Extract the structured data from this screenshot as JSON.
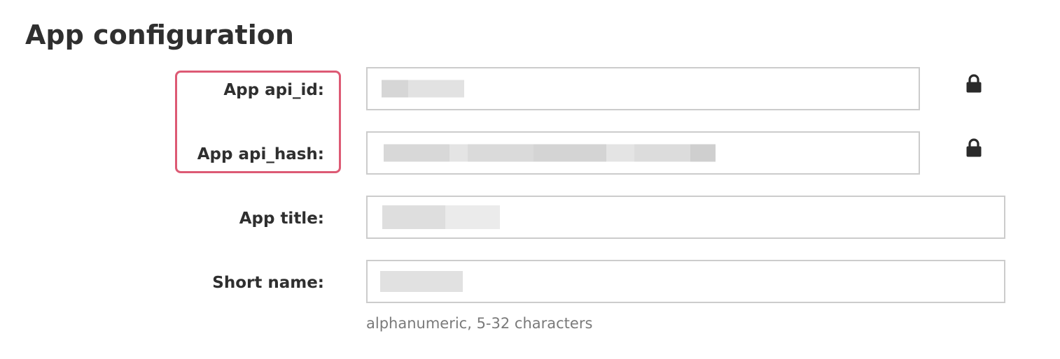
{
  "page": {
    "title": "App configuration"
  },
  "fields": {
    "api_id": {
      "label": "App api_id:",
      "locked": true,
      "icon": "lock-icon"
    },
    "api_hash": {
      "label": "App api_hash:",
      "locked": true,
      "icon": "lock-icon"
    },
    "title": {
      "label": "App title:"
    },
    "short_name": {
      "label": "Short name:",
      "hint": "alphanumeric, 5-32 characters"
    }
  },
  "colors": {
    "highlight_border": "#dd5a74",
    "input_border": "#cccccc",
    "redaction_light": "#e8e8e8",
    "redaction_mid": "#dcdcdc",
    "redaction_dark": "#cfcfcf",
    "hint_text": "#7a7a7a"
  }
}
